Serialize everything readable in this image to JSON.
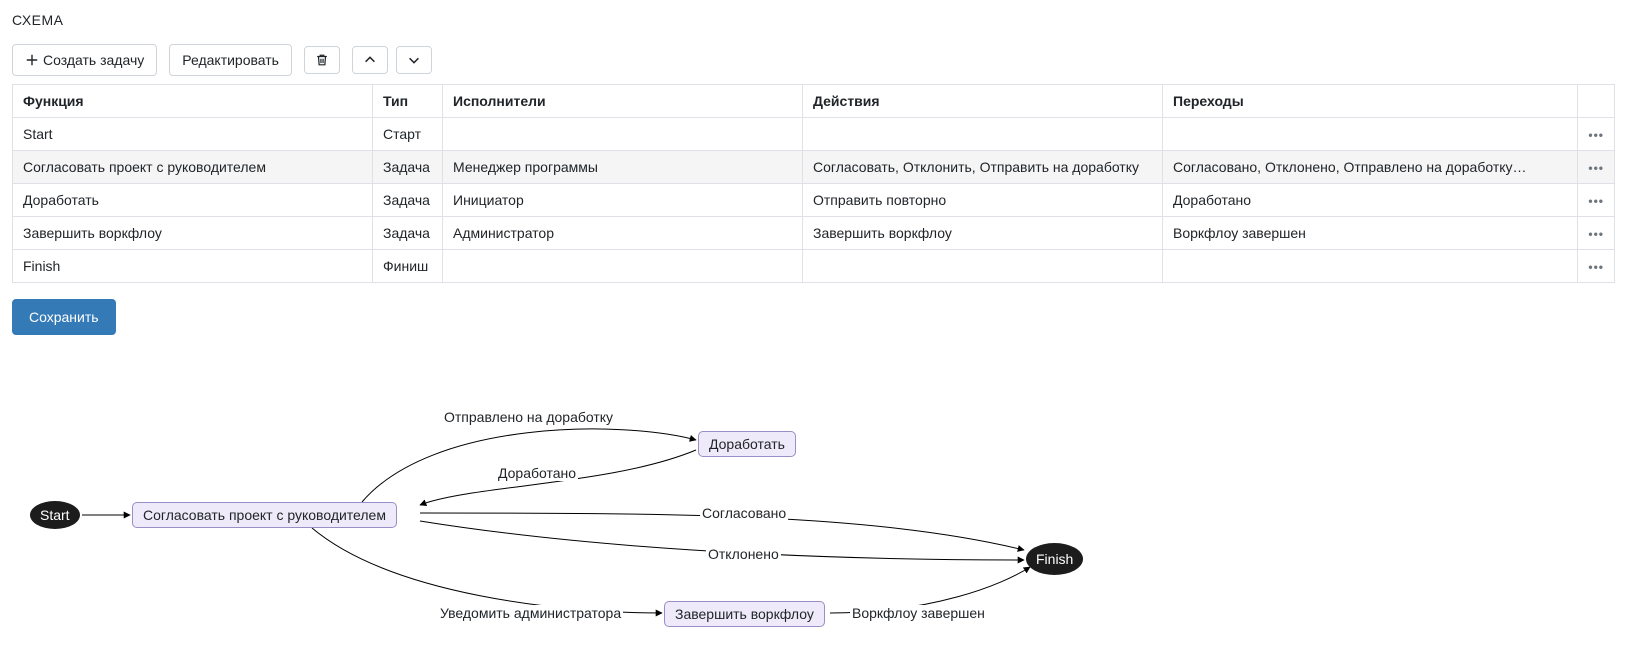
{
  "section_title": "СХЕМА",
  "toolbar": {
    "create_label": "Создать задачу",
    "edit_label": "Редактировать"
  },
  "table": {
    "headers": {
      "func": "Функция",
      "type": "Тип",
      "performers": "Исполнители",
      "actions": "Действия",
      "transitions": "Переходы"
    },
    "rows": [
      {
        "func": "Start",
        "type": "Старт",
        "performers": "",
        "actions": "",
        "transitions": "",
        "highlight": false
      },
      {
        "func": "Согласовать проект с руководителем",
        "type": "Задача",
        "performers": "Менеджер программы",
        "actions": "Согласовать, Отклонить, Отправить на доработку",
        "transitions": "Согласовано, Отклонено, Отправлено на доработку…",
        "highlight": true
      },
      {
        "func": "Доработать",
        "type": "Задача",
        "performers": "Инициатор",
        "actions": "Отправить повторно",
        "transitions": "Доработано",
        "highlight": false
      },
      {
        "func": "Завершить воркфлоу",
        "type": "Задача",
        "performers": "Администратор",
        "actions": "Завершить воркфлоу",
        "transitions": "Воркфлоу завершен",
        "highlight": false
      },
      {
        "func": "Finish",
        "type": "Финиш",
        "performers": "",
        "actions": "",
        "transitions": "",
        "highlight": false
      }
    ]
  },
  "save_label": "Сохранить",
  "diagram": {
    "nodes": {
      "start": "Start",
      "approve": "Согласовать проект с руководителем",
      "rework": "Доработать",
      "complete": "Завершить воркфлоу",
      "finish": "Finish"
    },
    "edges": {
      "sent_rework": "Отправлено на доработку",
      "reworked": "Доработано",
      "approved": "Согласовано",
      "declined": "Отклонено",
      "notify_admin": "Уведомить администратора",
      "wf_done": "Воркфлоу завершен"
    }
  }
}
